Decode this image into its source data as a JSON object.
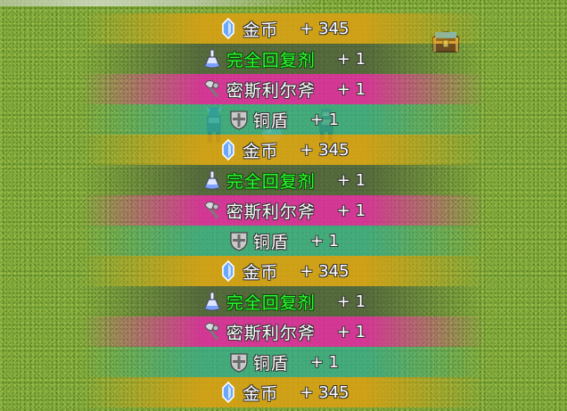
{
  "item_log": [
    {
      "icon": "crystal-icon",
      "name": "金币",
      "qty": "+ 345",
      "band": "gold",
      "name_color": "white"
    },
    {
      "icon": "potion-icon",
      "name": "完全回复剂",
      "qty": "+ 1",
      "band": "dark",
      "name_color": "green"
    },
    {
      "icon": "axe-icon",
      "name": "密斯利尔斧",
      "qty": "+ 1",
      "band": "pink",
      "name_color": "white"
    },
    {
      "icon": "shield-icon",
      "name": "铜盾",
      "qty": "+ 1",
      "band": "teal",
      "name_color": "white"
    },
    {
      "icon": "crystal-icon",
      "name": "金币",
      "qty": "+ 345",
      "band": "gold",
      "name_color": "white"
    },
    {
      "icon": "potion-icon",
      "name": "完全回复剂",
      "qty": "+ 1",
      "band": "dark",
      "name_color": "green"
    },
    {
      "icon": "axe-icon",
      "name": "密斯利尔斧",
      "qty": "+ 1",
      "band": "pink",
      "name_color": "white"
    },
    {
      "icon": "shield-icon",
      "name": "铜盾",
      "qty": "+ 1",
      "band": "teal",
      "name_color": "white"
    },
    {
      "icon": "crystal-icon",
      "name": "金币",
      "qty": "+ 345",
      "band": "gold",
      "name_color": "white"
    },
    {
      "icon": "potion-icon",
      "name": "完全回复剂",
      "qty": "+ 1",
      "band": "dark",
      "name_color": "green"
    },
    {
      "icon": "axe-icon",
      "name": "密斯利尔斧",
      "qty": "+ 1",
      "band": "pink",
      "name_color": "white"
    },
    {
      "icon": "shield-icon",
      "name": "铜盾",
      "qty": "+ 1",
      "band": "teal",
      "name_color": "white"
    },
    {
      "icon": "crystal-icon",
      "name": "金币",
      "qty": "+ 345",
      "band": "gold",
      "name_color": "white"
    }
  ],
  "colors": {
    "grass": "#7fa83a",
    "gold_band": "#d6a014",
    "dark_band": "#465538",
    "pink_band": "#de28a0",
    "teal_band": "#32aa8c",
    "rare_text": "#2bff2b"
  },
  "scene": {
    "chest_icon": "treasure-chest-icon",
    "characters": [
      "knight-sprite",
      "mage-sprite",
      "slime-sprite"
    ]
  }
}
